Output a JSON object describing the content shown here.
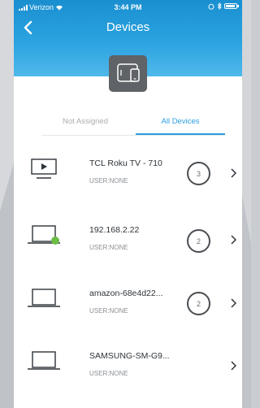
{
  "status_bar": {
    "carrier": "Verizon",
    "time": "3:44 PM"
  },
  "header": {
    "title": "Devices",
    "back_icon": "chevron-left-icon",
    "tile_icon": "devices-icon",
    "color": "#1a8fd0"
  },
  "tabs": [
    {
      "label": "Not Assigned",
      "active": false
    },
    {
      "label": "All Devices",
      "active": true
    }
  ],
  "accent_color": "#2b9de0",
  "devices": [
    {
      "name": "TCL Roku TV - 710",
      "user": "USER:NONE",
      "count": "3",
      "icon": "tv-icon",
      "online": false
    },
    {
      "name": "192.168.2.22",
      "user": "USER:NONE",
      "count": "2",
      "icon": "laptop-icon",
      "online": true
    },
    {
      "name": "amazon-68e4d22...",
      "user": "USER:NONE",
      "count": "2",
      "icon": "laptop-icon",
      "online": false
    },
    {
      "name": "SAMSUNG-SM-G9...",
      "user": "USER:NONE",
      "count": "",
      "icon": "laptop-icon",
      "online": false
    }
  ]
}
